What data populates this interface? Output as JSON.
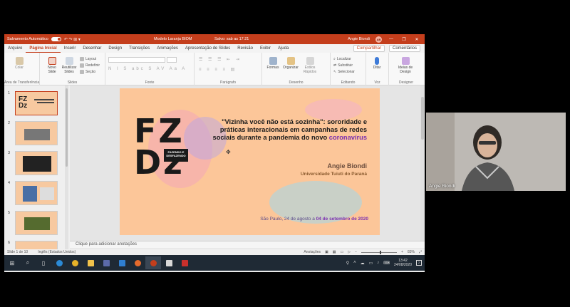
{
  "window": {
    "autosave_label": "Salvamento Automático",
    "autosave_state": "●",
    "doc_title": "Modelo Laranja BIOM",
    "saved_status": "Salvo: sab as 17:21",
    "user_name": "Angie Biondi",
    "user_initials": "AB",
    "quick_access": "↶ ↷ ⊞ ▾",
    "controls": {
      "min": "—",
      "restore": "❐",
      "close": "✕"
    }
  },
  "ribbon_tabs": [
    "Arquivo",
    "Página Inicial",
    "Inserir",
    "Desenhar",
    "Design",
    "Transições",
    "Animações",
    "Apresentação de Slides",
    "Revisão",
    "Exibir",
    "Ajuda"
  ],
  "share_label": "Compartilhar",
  "comments_label": "Comentários",
  "ribbon": {
    "clipboard": {
      "paste": "Colar",
      "group": "Área de Transferência"
    },
    "slides": {
      "new_slide": "Novo Slide",
      "reuse": "Reutilizar Slides",
      "layout": "Layout",
      "reset": "Redefinir",
      "section": "Seção",
      "group": "Slides"
    },
    "font": {
      "group": "Fonte",
      "buttons": "N I S abc S AV Aa A"
    },
    "paragraph": {
      "group": "Parágrafo"
    },
    "drawing": {
      "shapes": "Formas",
      "arrange": "Organizar",
      "quick_styles": "Estilos Rápidos",
      "group": "Desenho"
    },
    "editing": {
      "find": "Localizar",
      "replace": "Substituir",
      "select": "Selecionar",
      "group": "Editando"
    },
    "voice": {
      "dictate": "Ditar",
      "group": "Voz"
    },
    "designer": {
      "ideas": "Ideias de Design",
      "group": "Designer"
    }
  },
  "thumbnails": [
    {
      "num": "1"
    },
    {
      "num": "2"
    },
    {
      "num": "3"
    },
    {
      "num": "4"
    },
    {
      "num": "5"
    },
    {
      "num": "6"
    }
  ],
  "slide": {
    "logo_letters": "FZ\nDz",
    "logo_box": "FAZENDO E DESFAZENDO GÊNERO NA REDE",
    "title_part1": "\"Vizinha você não está sozinha\": sororidade e práticas interacionais em campanhas de redes sociais durante a pandemia do novo ",
    "title_highlight": "coronavírus",
    "author": "Angie Biondi",
    "university": "Universidade Tuiuti do Paraná",
    "date_part1": "São Paulo, 24 de agosto a ",
    "date_highlight": "04 de setembro de 2020"
  },
  "notes_placeholder": "Clique para adicionar anotações",
  "status": {
    "slide_count": "Slide 1 de 10",
    "language": "Inglês (Estados Unidos)",
    "notes_btn": "Anotações",
    "zoom": "83%"
  },
  "taskbar": {
    "time": "13:42",
    "date": "24/08/2020",
    "notification_count": "2"
  },
  "participant": {
    "name": "Angie Biondi"
  }
}
